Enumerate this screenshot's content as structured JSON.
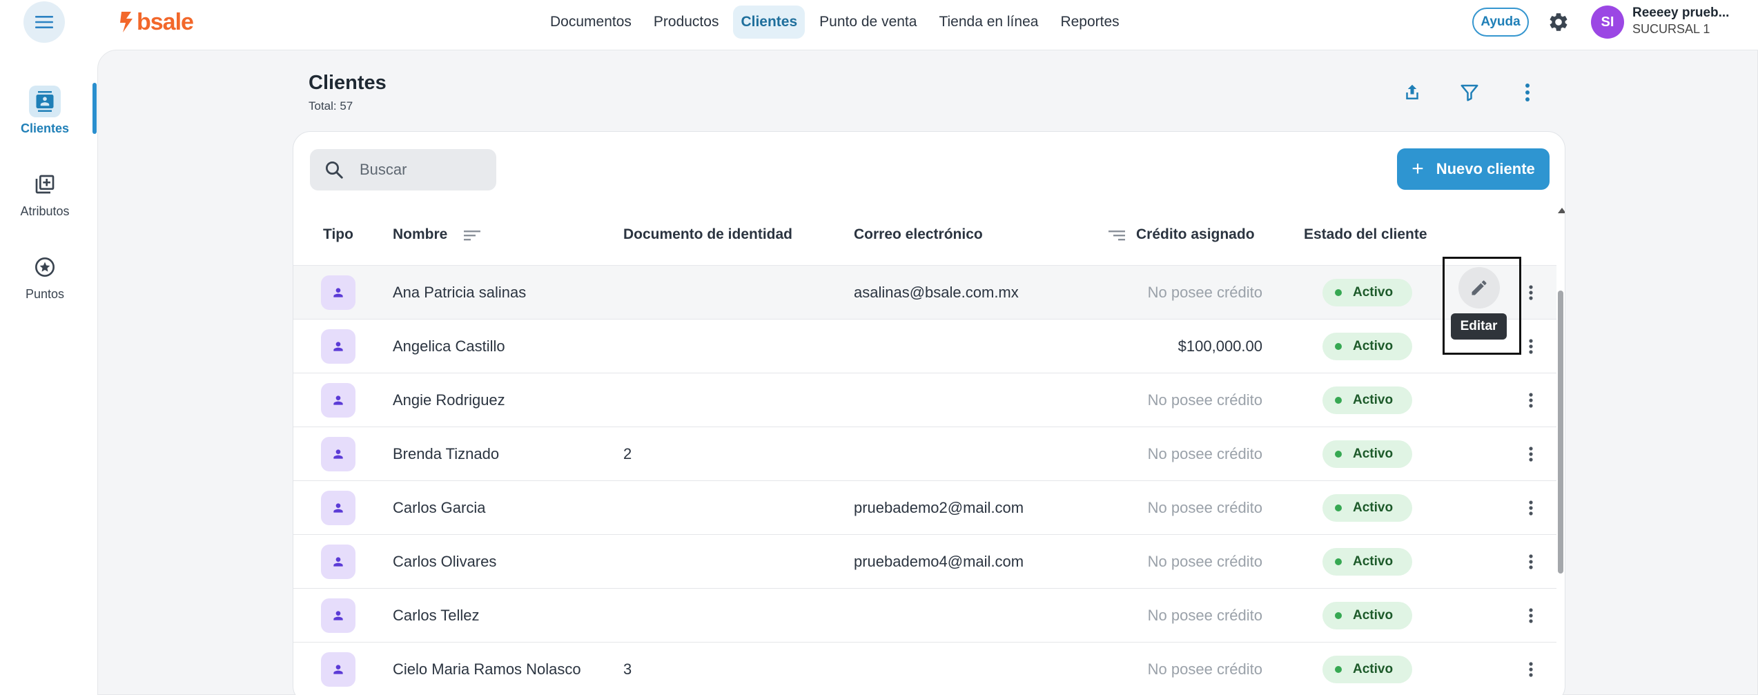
{
  "app": {
    "logo_text": "bsale",
    "nav": [
      "Documentos",
      "Productos",
      "Clientes",
      "Punto de venta",
      "Tienda en línea",
      "Reportes"
    ],
    "help_label": "Ayuda",
    "user_initials": "SI",
    "user_name": "Reeeey prueb...",
    "user_branch": "SUCURSAL 1"
  },
  "sidebar": {
    "items": [
      {
        "label": "Clientes",
        "icon": "contacts-icon"
      },
      {
        "label": "Atributos",
        "icon": "library-add-icon"
      },
      {
        "label": "Puntos",
        "icon": "star-circle-icon"
      }
    ]
  },
  "page": {
    "title": "Clientes",
    "total": "Total: 57"
  },
  "search": {
    "placeholder": "Buscar"
  },
  "new_button": {
    "plus": "+",
    "label": "Nuevo cliente"
  },
  "table": {
    "columns": [
      "Tipo",
      "Nombre",
      "Documento de identidad",
      "Correo electrónico",
      "Crédito asignado",
      "Estado del cliente"
    ],
    "rows": [
      {
        "name": "Ana Patricia salinas",
        "doc": "",
        "email": "asalinas@bsale.com.mx",
        "credit": "No posee crédito",
        "status": "Activo"
      },
      {
        "name": "Angelica Castillo",
        "doc": "",
        "email": "",
        "credit": "$100,000.00",
        "status": "Activo"
      },
      {
        "name": "Angie Rodriguez",
        "doc": "",
        "email": "",
        "credit": "No posee crédito",
        "status": "Activo"
      },
      {
        "name": "Brenda Tiznado",
        "doc": "2",
        "email": "",
        "credit": "No posee crédito",
        "status": "Activo"
      },
      {
        "name": "Carlos Garcia",
        "doc": "",
        "email": "pruebademo2@mail.com",
        "credit": "No posee crédito",
        "status": "Activo"
      },
      {
        "name": "Carlos Olivares",
        "doc": "",
        "email": "pruebademo4@mail.com",
        "credit": "No posee crédito",
        "status": "Activo"
      },
      {
        "name": "Carlos Tellez",
        "doc": "",
        "email": "",
        "credit": "No posee crédito",
        "status": "Activo"
      },
      {
        "name": "Cielo Maria Ramos Nolasco",
        "doc": "3",
        "email": "",
        "credit": "No posee crédito",
        "status": "Activo"
      }
    ]
  },
  "tooltip": {
    "edit": "Editar"
  },
  "colors": {
    "accent": "#2e95d1",
    "brand": "#f2672a",
    "active_status_bg": "#e0f4e4",
    "active_status_dot": "#36a852",
    "type_badge_bg": "#e6ddfb",
    "avatar": "#9b47e4"
  }
}
